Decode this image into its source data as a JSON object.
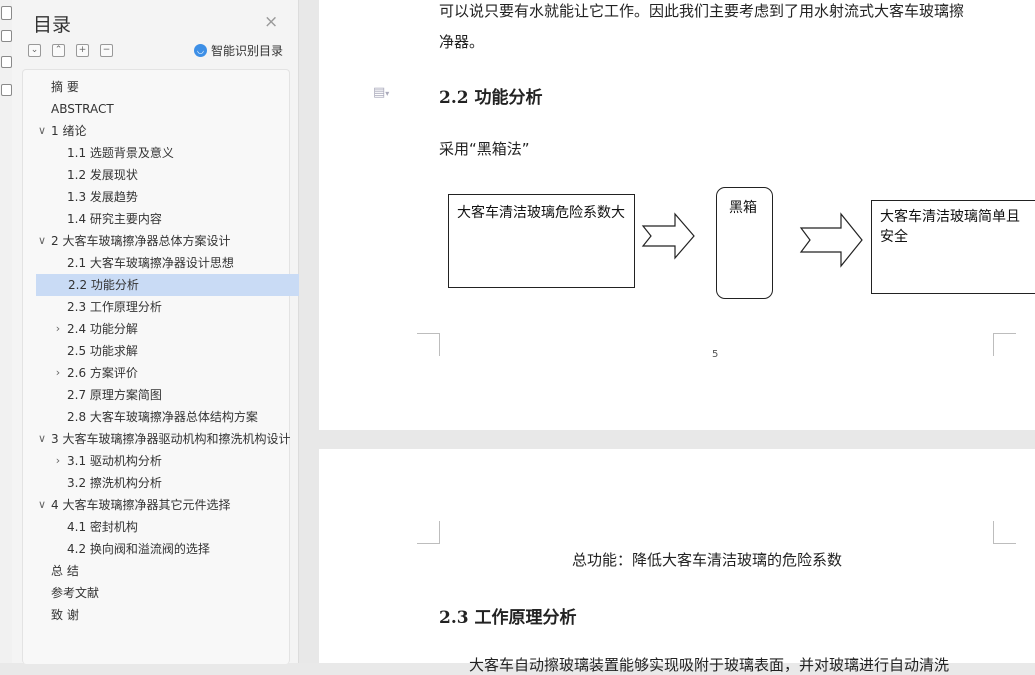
{
  "nav": {
    "title": "目录",
    "close_glyph": "×",
    "toolbar": [
      "⌄",
      "⌃",
      "+",
      "−"
    ],
    "smart_label": "智能识别目录",
    "items": [
      {
        "label": "摘    要",
        "level": 0,
        "state": "none"
      },
      {
        "label": "ABSTRACT",
        "level": 0,
        "state": "none"
      },
      {
        "label": "1  绪论",
        "level": 0,
        "state": "expanded"
      },
      {
        "label": "1.1 选题背景及意义",
        "level": 1,
        "state": "none"
      },
      {
        "label": "1.2 发展现状",
        "level": 1,
        "state": "none"
      },
      {
        "label": "1.3 发展趋势",
        "level": 1,
        "state": "none"
      },
      {
        "label": "1.4 研究主要内容",
        "level": 1,
        "state": "none"
      },
      {
        "label": "2  大客车玻璃擦净器总体方案设计",
        "level": 0,
        "state": "expanded"
      },
      {
        "label": "2.1  大客车玻璃擦净器设计思想",
        "level": 1,
        "state": "none"
      },
      {
        "label": "2.2 功能分析",
        "level": 1,
        "state": "selected"
      },
      {
        "label": "2.3 工作原理分析",
        "level": 1,
        "state": "none"
      },
      {
        "label": "2.4 功能分解",
        "level": 1,
        "state": "collapsed"
      },
      {
        "label": "2.5 功能求解",
        "level": 1,
        "state": "none"
      },
      {
        "label": "2.6 方案评价",
        "level": 1,
        "state": "collapsed"
      },
      {
        "label": "2.7 原理方案简图",
        "level": 1,
        "state": "none"
      },
      {
        "label": "2.8  大客车玻璃擦净器总体结构方案",
        "level": 1,
        "state": "none"
      },
      {
        "label": "3  大客车玻璃擦净器驱动机构和擦洗机构设计",
        "level": 0,
        "state": "expanded"
      },
      {
        "label": "3.1  驱动机构分析",
        "level": 1,
        "state": "collapsed"
      },
      {
        "label": "3.2 擦洗机构分析",
        "level": 1,
        "state": "none"
      },
      {
        "label": "4  大客车玻璃擦净器其它元件选择",
        "level": 0,
        "state": "expanded"
      },
      {
        "label": "4.1 密封机构",
        "level": 1,
        "state": "none"
      },
      {
        "label": "4.2 换向阀和溢流阀的选择",
        "level": 1,
        "state": "none"
      },
      {
        "label": "总    结",
        "level": 0,
        "state": "none"
      },
      {
        "label": "参考文献",
        "level": 0,
        "state": "none"
      },
      {
        "label": "致    谢",
        "level": 0,
        "state": "none"
      }
    ]
  },
  "doc": {
    "page1": {
      "line1": "可以说只要有水就能让它工作。因此我们主要考虑到了用水射流式大客车玻璃擦",
      "line2": "净器。",
      "heading": "2.2 功能分析",
      "method": "采用“黑箱法”",
      "box1": "大客车清洁玻璃危险系数大",
      "box2": "黑箱",
      "box3": "大客车清洁玻璃简单且安全",
      "page_number": "5"
    },
    "page2": {
      "total_function": "总功能：降低大客车清洁玻璃的危险系数",
      "heading": "2.3 工作原理分析",
      "partial_line": "大客车自动擦玻璃装置能够实现吸附于玻璃表面，并对玻璃进行自动清洗"
    }
  },
  "colors": {
    "selection": "#c9dbf5",
    "accent": "#3d8fe6"
  }
}
